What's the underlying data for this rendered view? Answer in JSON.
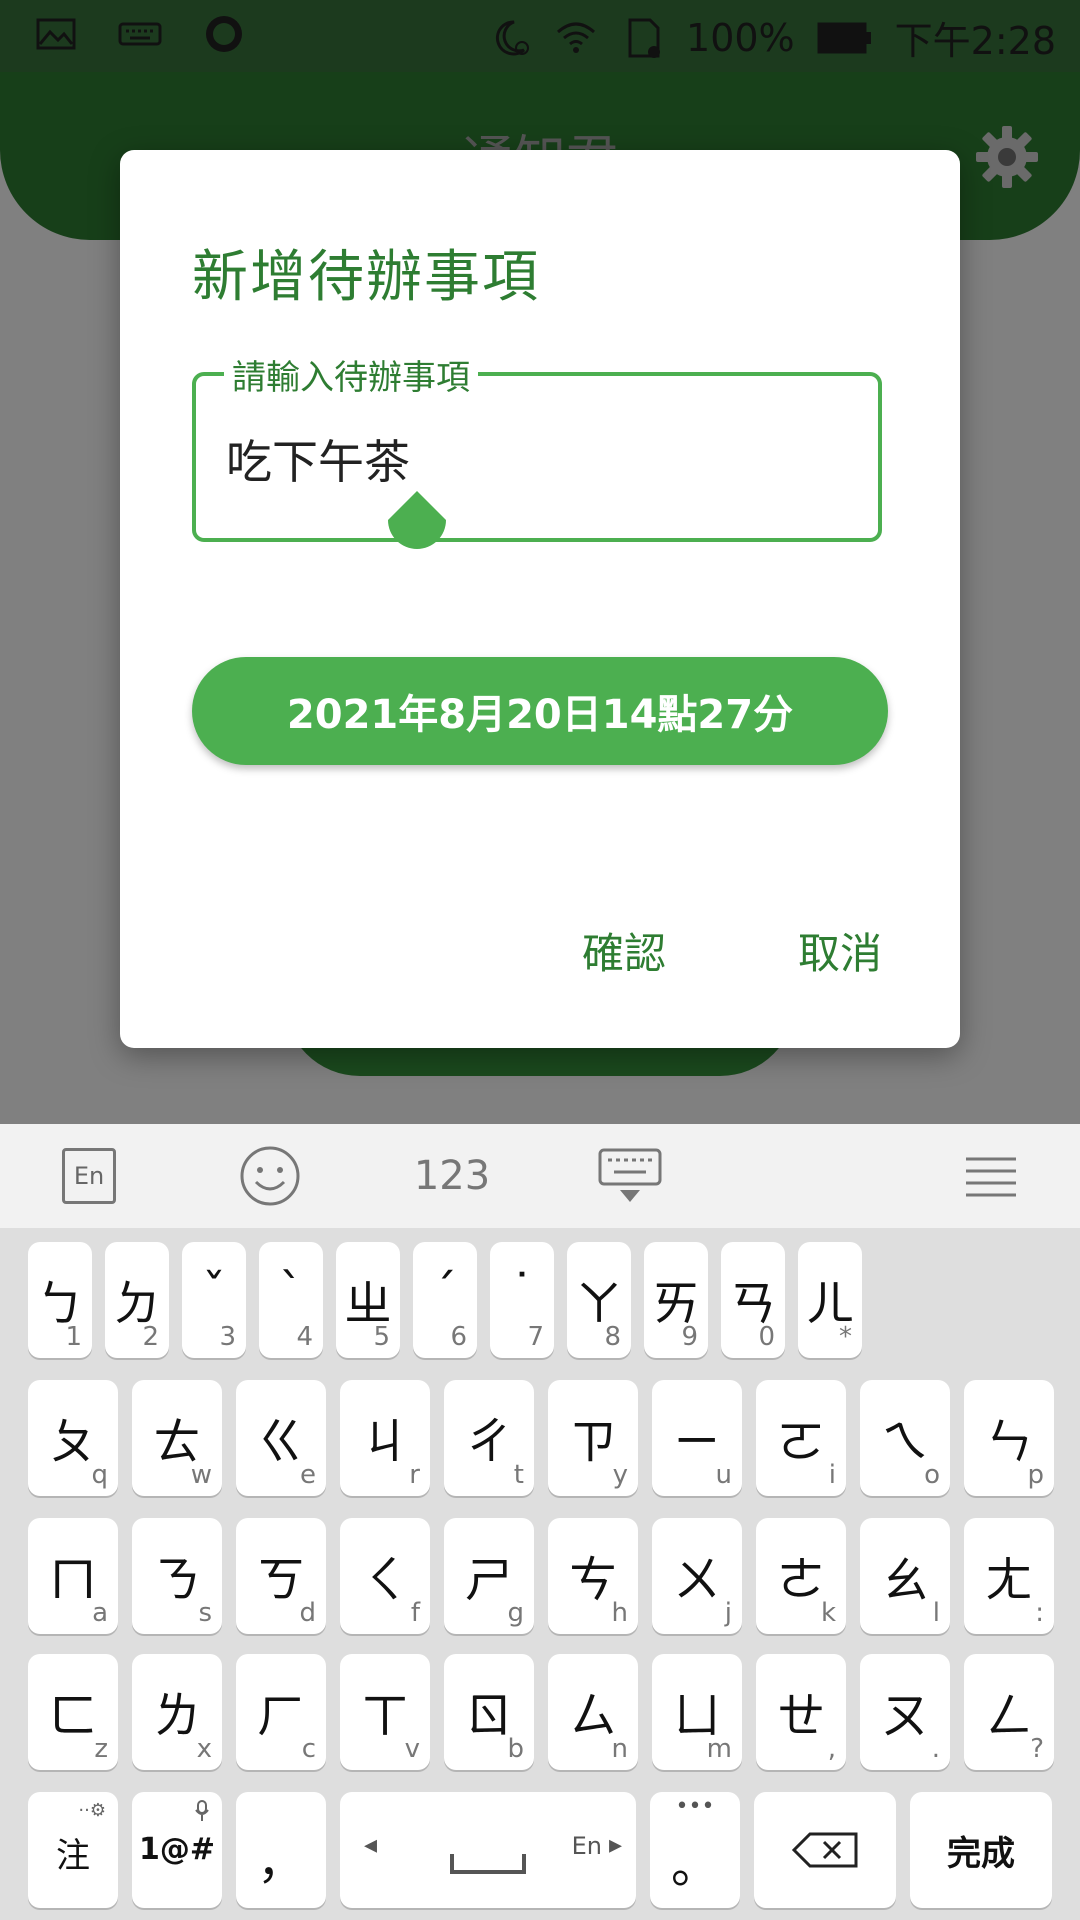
{
  "status_bar": {
    "battery": "100%",
    "time": "下午2:28"
  },
  "app": {
    "title": "通知君"
  },
  "dialog": {
    "title": "新增待辦事項",
    "field_label": "請輸入待辦事項",
    "field_value": "吃下午茶",
    "date_button": "2021年8月20日14點27分",
    "confirm": "確認",
    "cancel": "取消"
  },
  "keyboard_toolbar": {
    "lang": "En",
    "numbers": "123"
  },
  "keyboard": {
    "row1": [
      {
        "main": "ㄅ",
        "sub": "1"
      },
      {
        "main": "ㄉ",
        "sub": "2"
      },
      {
        "main": "ˇ",
        "sub": "3"
      },
      {
        "main": "ˋ",
        "sub": "4"
      },
      {
        "main": "ㄓ",
        "sub": "5"
      },
      {
        "main": "ˊ",
        "sub": "6"
      },
      {
        "main": "˙",
        "sub": "7"
      },
      {
        "main": "ㄚ",
        "sub": "8"
      },
      {
        "main": "ㄞ",
        "sub": "9"
      },
      {
        "main": "ㄢ",
        "sub": "0"
      },
      {
        "main": "ㄦ",
        "sub": "*"
      }
    ],
    "row2": [
      {
        "main": "ㄆ",
        "sub": "q"
      },
      {
        "main": "ㄊ",
        "sub": "w"
      },
      {
        "main": "ㄍ",
        "sub": "e"
      },
      {
        "main": "ㄐ",
        "sub": "r"
      },
      {
        "main": "ㄔ",
        "sub": "t"
      },
      {
        "main": "ㄗ",
        "sub": "y"
      },
      {
        "main": "ㄧ",
        "sub": "u"
      },
      {
        "main": "ㄛ",
        "sub": "i"
      },
      {
        "main": "ㄟ",
        "sub": "o"
      },
      {
        "main": "ㄣ",
        "sub": "p"
      }
    ],
    "row3": [
      {
        "main": "ㄇ",
        "sub": "a"
      },
      {
        "main": "ㄋ",
        "sub": "s"
      },
      {
        "main": "ㄎ",
        "sub": "d"
      },
      {
        "main": "ㄑ",
        "sub": "f"
      },
      {
        "main": "ㄕ",
        "sub": "g"
      },
      {
        "main": "ㄘ",
        "sub": "h"
      },
      {
        "main": "ㄨ",
        "sub": "j"
      },
      {
        "main": "ㄜ",
        "sub": "k"
      },
      {
        "main": "ㄠ",
        "sub": "l"
      },
      {
        "main": "ㄤ",
        "sub": ":"
      }
    ],
    "row4": [
      {
        "main": "ㄈ",
        "sub": "z"
      },
      {
        "main": "ㄌ",
        "sub": "x"
      },
      {
        "main": "ㄏ",
        "sub": "c"
      },
      {
        "main": "ㄒ",
        "sub": "v"
      },
      {
        "main": "ㄖ",
        "sub": "b"
      },
      {
        "main": "ㄙ",
        "sub": "n"
      },
      {
        "main": "ㄩ",
        "sub": "m"
      },
      {
        "main": "ㄝ",
        "sub": ","
      },
      {
        "main": "ㄡ",
        "sub": "."
      },
      {
        "main": "ㄥ",
        "sub": "?"
      }
    ],
    "bottom": {
      "zhuyin": "注",
      "symbols": "1@#",
      "comma": "，",
      "space_lang": "En",
      "period": "。",
      "done": "完成"
    }
  }
}
